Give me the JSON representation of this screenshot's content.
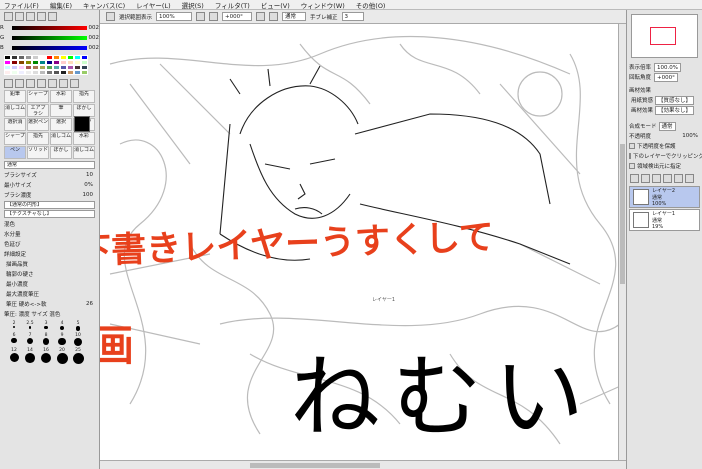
{
  "menu": [
    "ファイル(F)",
    "編集(E)",
    "キャンバス(C)",
    "レイヤー(L)",
    "選択(S)",
    "フィルタ(T)",
    "ビュー(V)",
    "ウィンドウ(W)",
    "その他(O)"
  ],
  "toolbar": {
    "selection_label": "選択範囲表示",
    "zoom": "100%",
    "angle": "+000°",
    "mode": "通常",
    "stabilizer_label": "手ブレ補正",
    "stabilizer": "3"
  },
  "left": {
    "color_values": [
      "002",
      "002",
      "002"
    ],
    "tools": [
      "鉛筆",
      "シャープ",
      "水彩",
      "指先",
      "消しゴム",
      "エアブラシ",
      "筆",
      "ぼかし",
      "選択消",
      "選択ペン",
      "選択",
      "バケツ",
      "シャープ",
      "指先",
      "消しゴム",
      "水彩",
      "ペン",
      "ソリッド",
      "ぼかし",
      "消しゴム"
    ],
    "blend": "通常",
    "brush_size_label": "ブラシサイズ",
    "brush_size": "10",
    "min_size_label": "最小サイズ",
    "min_size": "0%",
    "density_label": "ブラシ濃度",
    "density": "100",
    "shape1": "【通常の円形】",
    "shape2": "【テクスチャなし】",
    "mix_label": "混色",
    "water_label": "水分量",
    "extend_label": "色延び",
    "detail_label": "詳細設定",
    "quality_label": "描画品質",
    "edge_label": "輪郭の硬さ",
    "min_density_label": "最小濃度",
    "max_pressure_label": "最大濃度筆圧",
    "pressure_label": "筆圧 硬め<->軟",
    "pressure_value": "26",
    "pressure_opts": "筆圧: 濃度 サイズ 混色",
    "dot_sizes": [
      "2",
      "2.5",
      "3",
      "4",
      "5",
      "6",
      "7",
      "8",
      "9",
      "10",
      "12",
      "14",
      "16",
      "20",
      "25"
    ]
  },
  "canvas": {
    "layer_label": "レイヤー1",
    "note_line1": "下書きレイヤーうすくして",
    "note_line2": "線画",
    "note_big": "ねむい"
  },
  "right": {
    "zoom_label": "表示倍率",
    "zoom": "100.0%",
    "angle_label": "回転角度",
    "angle": "+000°",
    "paper_label": "画材効果",
    "paper_tex_label": "用紙質感",
    "paper_tex": "【質感なし】",
    "paper_eff_label": "画材効果",
    "paper_eff": "【効果なし】",
    "blend_label": "合成モード",
    "blend": "通常",
    "opacity_label": "不透明度",
    "opacity": "100%",
    "chk1": "下透明度を保護",
    "chk2": "下のレイヤーでクリッピング",
    "chk3": "領域検出元に指定",
    "layers": [
      {
        "name": "レイヤー2",
        "mode": "通常",
        "opacity": "100%"
      },
      {
        "name": "レイヤー1",
        "mode": "通常",
        "opacity": "19%"
      }
    ]
  },
  "colors": {
    "accent": "#e8401c",
    "selection": "#b8c8ee"
  }
}
